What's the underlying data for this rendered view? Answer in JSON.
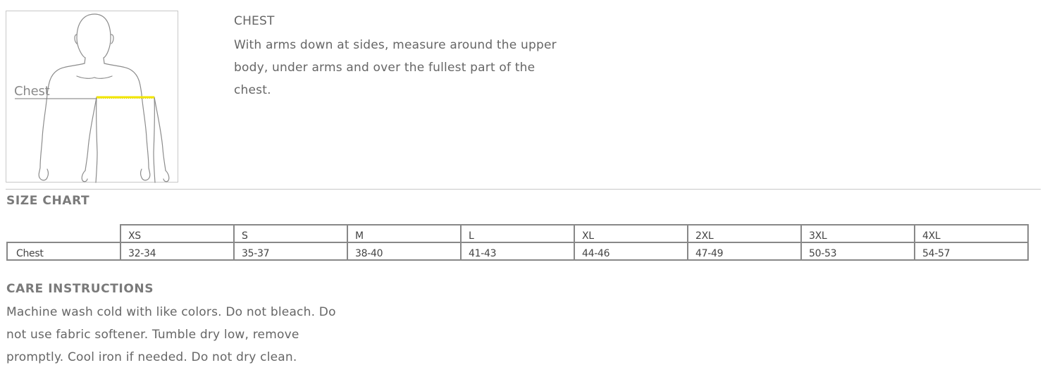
{
  "figure": {
    "label": "Chest",
    "icon": "human-torso-outline",
    "accent_color": "#f2e600"
  },
  "measurement": {
    "title": "CHEST",
    "description": "With arms down at sides, measure around the upper body, under arms and over the fullest part of the chest."
  },
  "size_chart": {
    "heading": "SIZE CHART",
    "columns": [
      "XS",
      "S",
      "M",
      "L",
      "XL",
      "2XL",
      "3XL",
      "4XL"
    ],
    "rows": [
      {
        "label": "Chest",
        "values": [
          "32-34",
          "35-37",
          "38-40",
          "41-43",
          "44-46",
          "47-49",
          "50-53",
          "54-57"
        ]
      }
    ]
  },
  "care": {
    "heading": "CARE INSTRUCTIONS",
    "text": "Machine wash cold with like colors. Do not bleach. Do not use fabric softener. Tumble dry low, remove promptly. Cool iron if needed. Do not dry clean."
  }
}
